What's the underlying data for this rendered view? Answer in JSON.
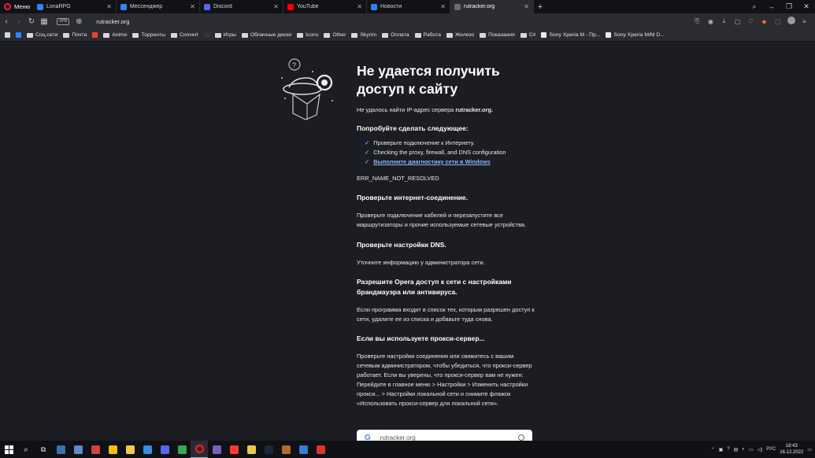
{
  "browser": {
    "menu_label": "Меню",
    "tabs": [
      {
        "title": "LonaRPG",
        "icon": "vk-icon",
        "color": "#2787f5",
        "active": false
      },
      {
        "title": "Мессенджер",
        "icon": "messenger-icon",
        "color": "#2787f5",
        "active": false
      },
      {
        "title": "Discord",
        "icon": "discord-icon",
        "color": "#5865f2",
        "active": false
      },
      {
        "title": "YouTube",
        "icon": "youtube-icon",
        "color": "#ff0000",
        "active": false
      },
      {
        "title": "Новости",
        "icon": "vk-icon",
        "color": "#2787f5",
        "active": false
      },
      {
        "title": "rutracker.org",
        "icon": "globe-icon",
        "color": "#6b6b70",
        "active": true
      }
    ],
    "vpn_label": "VPN",
    "url": "rutracker.org"
  },
  "bookmarks": [
    {
      "label": "",
      "icon": "bookmarks-icon",
      "color": "#d8d8d8"
    },
    {
      "label": "",
      "icon": "vk-icon",
      "color": "#2787f5"
    },
    {
      "label": "Соц.сети",
      "icon": "folder-icon"
    },
    {
      "label": "Почта",
      "icon": "folder-icon"
    },
    {
      "label": "",
      "icon": "gmail-icon",
      "color": "#ea4335"
    },
    {
      "label": "Anime",
      "icon": "folder-icon"
    },
    {
      "label": "Торренты",
      "icon": "folder-icon"
    },
    {
      "label": "Convert",
      "icon": "folder-icon"
    },
    {
      "label": "",
      "icon": "spider-icon",
      "color": "#333333"
    },
    {
      "label": "Игры",
      "icon": "folder-icon"
    },
    {
      "label": "Облачные диски",
      "icon": "folder-icon"
    },
    {
      "label": "Icons",
      "icon": "folder-icon"
    },
    {
      "label": "Other",
      "icon": "folder-icon"
    },
    {
      "label": "Skyrim",
      "icon": "folder-icon"
    },
    {
      "label": "Оплата",
      "icon": "folder-icon"
    },
    {
      "label": "Работа",
      "icon": "folder-icon"
    },
    {
      "label": "Железо",
      "icon": "folder-icon"
    },
    {
      "label": "Показания",
      "icon": "folder-icon"
    },
    {
      "label": "C#",
      "icon": "folder-icon"
    },
    {
      "label": "Sony Xperia M - Пр...",
      "icon": "sony-icon",
      "color": "#eeeeee"
    },
    {
      "label": "Sony Xperia M/M D...",
      "icon": "sony-icon",
      "color": "#eeeeee"
    }
  ],
  "error": {
    "title": "Не удается получить доступ к сайту",
    "subtitle_prefix": "Не удалось найти IP-адрес сервера ",
    "subtitle_host": "rutracker.org.",
    "try_heading": "Попробуйте сделать следующее:",
    "checks": [
      "Проверьте подключение к Интернету.",
      "Checking the proxy, firewall, and DNS configuration",
      "Выполните диагностику сети в Windows"
    ],
    "error_code": "ERR_NAME_NOT_RESOLVED",
    "sections": [
      {
        "heading": "Проверьте интернет-соединение.",
        "body": "Проверьте подключение кабелей и перезапустите все маршрутизаторы и прочие используемые сетевые устройства."
      },
      {
        "heading": "Проверьте настройки DNS.",
        "body": "Уточните информацию у администратора сети."
      },
      {
        "heading": "Разрешите Opera доступ к сети с настройками брандмауэра или антивируса.",
        "body": "Если программа входит в список тех, которым разрешен доступ к сети, удалите ее из списка и добавьте туда снова."
      },
      {
        "heading": "Если вы используете прокси-сервер...",
        "body": "Проверьте настройки соединения или свяжитесь с вашим сетевым администратором, чтобы убедиться, что прокси-сервер работает. Если вы уверены, что прокси-сервер вам не нужен: Перейдите в главное меню > Настройки > Изменить настройки прокси... > Настройки локальной сети и снимите флажок «Использовать прокси-сервер для локальной сети»."
      }
    ],
    "search_query": "rutracker.org"
  },
  "taskbar": {
    "apps": [
      {
        "name": "windows-start-icon"
      },
      {
        "name": "search-icon"
      },
      {
        "name": "task-view-icon"
      },
      {
        "name": "calculator-icon",
        "color": "#3a6fb0"
      },
      {
        "name": "app-icon",
        "color": "#5a8ad0"
      },
      {
        "name": "app-icon",
        "color": "#c44"
      },
      {
        "name": "sticky-notes-icon",
        "color": "#f2c200"
      },
      {
        "name": "file-explorer-icon",
        "color": "#f2c94c"
      },
      {
        "name": "photos-icon",
        "color": "#3a8be0"
      },
      {
        "name": "discord-icon",
        "color": "#5865f2"
      },
      {
        "name": "chrome-icon",
        "color": "#34a853"
      },
      {
        "name": "opera-icon",
        "color": "#ff1b2d"
      },
      {
        "name": "app-icon",
        "color": "#7b5cc4"
      },
      {
        "name": "yandex-icon",
        "color": "#ff3b30"
      },
      {
        "name": "notes-icon",
        "color": "#e8c84a"
      },
      {
        "name": "steam-icon",
        "color": "#1b2838"
      },
      {
        "name": "app-icon",
        "color": "#b06b2b"
      },
      {
        "name": "browser-icon",
        "color": "#3a7bd5"
      },
      {
        "name": "app-icon",
        "color": "#d33"
      }
    ],
    "lang": "РУС",
    "time": "18:43",
    "date": "16.12.2022"
  }
}
